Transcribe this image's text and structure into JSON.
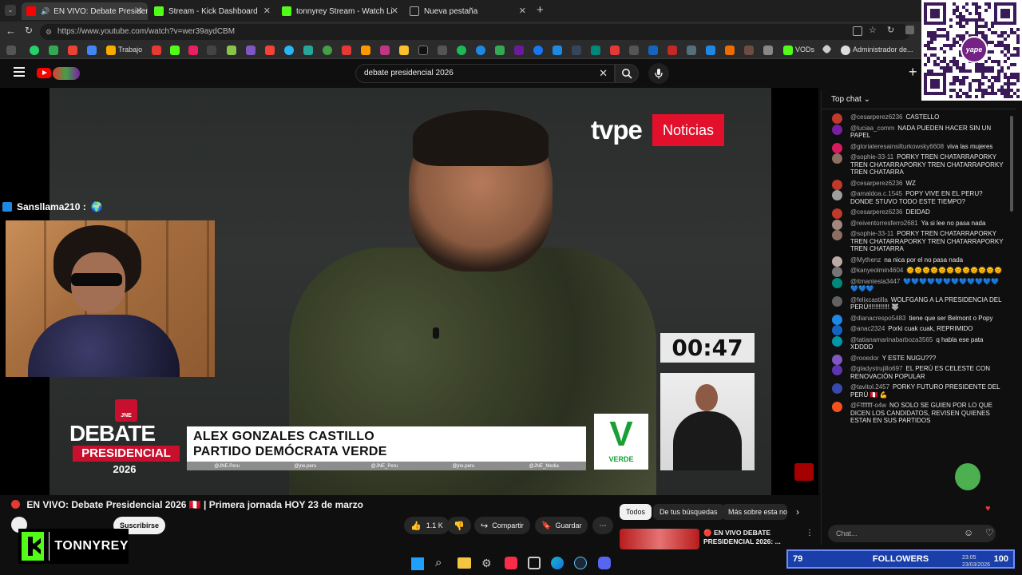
{
  "browser": {
    "tabs": [
      {
        "label": "EN VIVO: Debate Presiden",
        "active": true
      },
      {
        "label": "Stream - Kick Dashboard",
        "active": false
      },
      {
        "label": "tonnyrey Stream - Watch Live on K",
        "active": false
      },
      {
        "label": "Nueva pestaña",
        "active": false
      }
    ],
    "url": "https://www.youtube.com/watch?v=wer39aydCBM",
    "bookmarks": {
      "trabajo": "Trabajo",
      "vods": "VODs",
      "admin": "Administrador de..."
    }
  },
  "youtube": {
    "search_value": "debate presidencial 2026",
    "video_title": "EN VIVO: Debate Presidencial 2026 🇵🇪 | Primera jornada HOY 23 de marzo",
    "subscribe_label": "Suscribirse",
    "likes": "1.1 K",
    "share_label": "Compartir",
    "save_label": "Guardar",
    "chips": [
      "Todos",
      "De tus búsquedas",
      "Más sobre esta no"
    ],
    "rec_title": "🔴 EN VIVO DEBATE PRESIDENCIAL 2026: ..."
  },
  "broadcast": {
    "channel_logo": "tvpe",
    "channel_suffix": "Noticias",
    "timer": "00:47",
    "candidate_name": "ALEX GONZALES CASTILLO",
    "candidate_party": "PARTIDO DEMÓCRATA VERDE",
    "party_mark": "V",
    "party_word": "VERDE",
    "socials": [
      "@JNE.Peru",
      "@jne.peru",
      "@JNE_Peru",
      "@jne.peru",
      "@JNE_Media"
    ],
    "debate_line1": "DEBATE",
    "debate_line2": "PRESIDENCIAL",
    "debate_year": "2026",
    "jne": "JNE"
  },
  "overlay": {
    "cam_username": "Sansllama210 :",
    "kick_name": "TONNYREY",
    "followers_count": "79",
    "followers_label": "FOLLOWERS",
    "clock_time": "23:05",
    "clock_date": "23/03/2026",
    "yape_label": "yape"
  },
  "chat": {
    "header": "Top chat",
    "input_placeholder": "Chat...",
    "messages": [
      {
        "author": "@cesarperez6236",
        "text": "CASTELLO",
        "color": "#c0392b"
      },
      {
        "author": "@luciaa_comm",
        "text": "NADA PUEDEN HACER SIN UN PAPEL",
        "color": "#7b1fa2"
      },
      {
        "author": "@gloriateresainsilturkowsky6608",
        "text": "viva las mujeres",
        "color": "#d81b60"
      },
      {
        "author": "@sophie-33-11",
        "text": "PORKY TREN CHATARRAPORKY TREN CHATARRAPORKY TREN CHATARRAPORKY TREN CHATARRA",
        "color": "#8d6e63"
      },
      {
        "author": "@cesarperez6236",
        "text": "WZ",
        "color": "#c0392b"
      },
      {
        "author": "@amaldoa.c.1545",
        "text": "POPY VIVE EN EL PERU? DONDE STUVO TODO ESTE TIEMPO?",
        "color": "#9e9e9e"
      },
      {
        "author": "@cesarperez6236",
        "text": "DEIDAD",
        "color": "#c0392b"
      },
      {
        "author": "@reiventorresferro2681",
        "text": "Ya si lee no pasa nada",
        "color": "#a1887f"
      },
      {
        "author": "@sophie-33-11",
        "text": "PORKY TREN CHATARRAPORKY TREN CHATARRAPORKY TREN CHATARRAPORKY TREN CHATARRA",
        "color": "#8d6e63"
      },
      {
        "author": "@Mythenz",
        "text": "na nica por el no pasa nada",
        "color": "#bcaaa4"
      },
      {
        "author": "@kanyeolmin4604",
        "text": "🌞🌞🌞🌞🌞🌞🌞🌞🌞🌞🌞🌞",
        "color": "#757575"
      },
      {
        "author": "@itmantesla3447",
        "text": "💙💙💙💙💙💙💙💙💙💙💙💙💙💙💙",
        "color": "#00897b"
      },
      {
        "author": "@felixcastilla",
        "text": "WOLFGANG A LA PRESIDENCIA DEL PERÚ!!!!!!!!!!!! 🐺",
        "color": "#616161"
      },
      {
        "author": "@dianacrespo5483",
        "text": "tiene que ser Belmont o Popy",
        "color": "#1e88e5"
      },
      {
        "author": "@anac2324",
        "text": "Porki cuak cuak, REPRIMIDO",
        "color": "#1565c0"
      },
      {
        "author": "@tatianamarinabarboza3565",
        "text": "q habla ese pata XDDDD",
        "color": "#0097a7"
      },
      {
        "author": "@rooedor",
        "text": "Y ESTE NUGU???",
        "color": "#7e57c2"
      },
      {
        "author": "@gladystrujillo697",
        "text": "EL PERÚ ES CELESTE CON RENOVACIÓN POPULAR",
        "color": "#5e35b1"
      },
      {
        "author": "@tavitol.2457",
        "text": "PORKY FUTURO PRESIDENTE DEL PERÚ 🇵🇪 💪",
        "color": "#3949ab"
      },
      {
        "author": "@Ffffffff-o4w",
        "text": "NO SOLO SE GUIEN POR LO QUE DICEN LOS CANDIDATOS, REVISEN QUIENES ESTAN EN SUS PARTIDOS",
        "color": "#f4511e"
      }
    ]
  }
}
